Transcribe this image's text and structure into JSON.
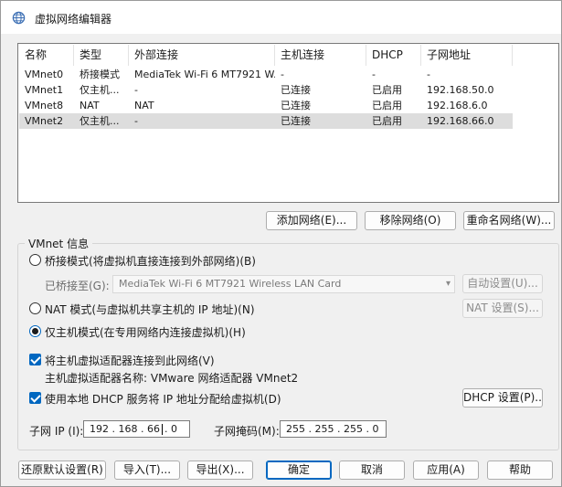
{
  "window": {
    "title": "虚拟网络编辑器"
  },
  "network_list": {
    "columns": [
      "名称",
      "类型",
      "外部连接",
      "主机连接",
      "DHCP",
      "子网地址"
    ],
    "rows": [
      {
        "name": "VMnet0",
        "type": "桥接模式",
        "external": "MediaTek Wi-Fi 6 MT7921 W...",
        "host": "-",
        "dhcp": "-",
        "subnet": "-",
        "selected": false
      },
      {
        "name": "VMnet1",
        "type": "仅主机...",
        "external": "-",
        "host": "已连接",
        "dhcp": "已启用",
        "subnet": "192.168.50.0",
        "selected": false
      },
      {
        "name": "VMnet8",
        "type": "NAT",
        "external": "NAT",
        "host": "已连接",
        "dhcp": "已启用",
        "subnet": "192.168.6.0",
        "selected": false
      },
      {
        "name": "VMnet2",
        "type": "仅主机...",
        "external": "-",
        "host": "已连接",
        "dhcp": "已启用",
        "subnet": "192.168.66.0",
        "selected": true
      }
    ]
  },
  "list_buttons": {
    "add": "添加网络(E)...",
    "remove": "移除网络(O)",
    "rename": "重命名网络(W)..."
  },
  "vmnet_info": {
    "group_label": "VMnet 信息",
    "bridged_label": "桥接模式(将虚拟机直接连接到外部网络)(B)",
    "bridged_to_label": "已桥接至(G):",
    "bridged_to_value": "MediaTek Wi-Fi 6 MT7921 Wireless LAN Card",
    "auto_settings": "自动设置(U)...",
    "nat_label": "NAT 模式(与虚拟机共享主机的 IP 地址)(N)",
    "nat_settings": "NAT 设置(S)...",
    "hostonly_label": "仅主机模式(在专用网络内连接虚拟机)(H)",
    "selected_mode": "hostonly",
    "connect_adapter_label": "将主机虚拟适配器连接到此网络(V)",
    "adapter_name_label": "主机虚拟适配器名称: VMware 网络适配器 VMnet2",
    "dhcp_label": "使用本地 DHCP 服务将 IP 地址分配给虚拟机(D)",
    "dhcp_settings": "DHCP 设置(P)...",
    "subnet_ip_label": "子网 IP (I):",
    "subnet_ip": {
      "o1": "192",
      "o2": "168",
      "o3": "66",
      "o4": "0"
    },
    "subnet_mask_label": "子网掩码(M):",
    "subnet_mask": {
      "o1": "255",
      "o2": "255",
      "o3": "255",
      "o4": "0"
    }
  },
  "bottom_buttons": {
    "restore": "还原默认设置(R)",
    "import": "导入(T)...",
    "export": "导出(X)...",
    "ok": "确定",
    "cancel": "取消",
    "apply": "应用(A)",
    "help": "帮助"
  },
  "icons": {
    "app": "network-globe-icon",
    "dropdown": "chevron-down-icon"
  },
  "colors": {
    "accent": "#0067c0",
    "selection": "#dddddd"
  }
}
